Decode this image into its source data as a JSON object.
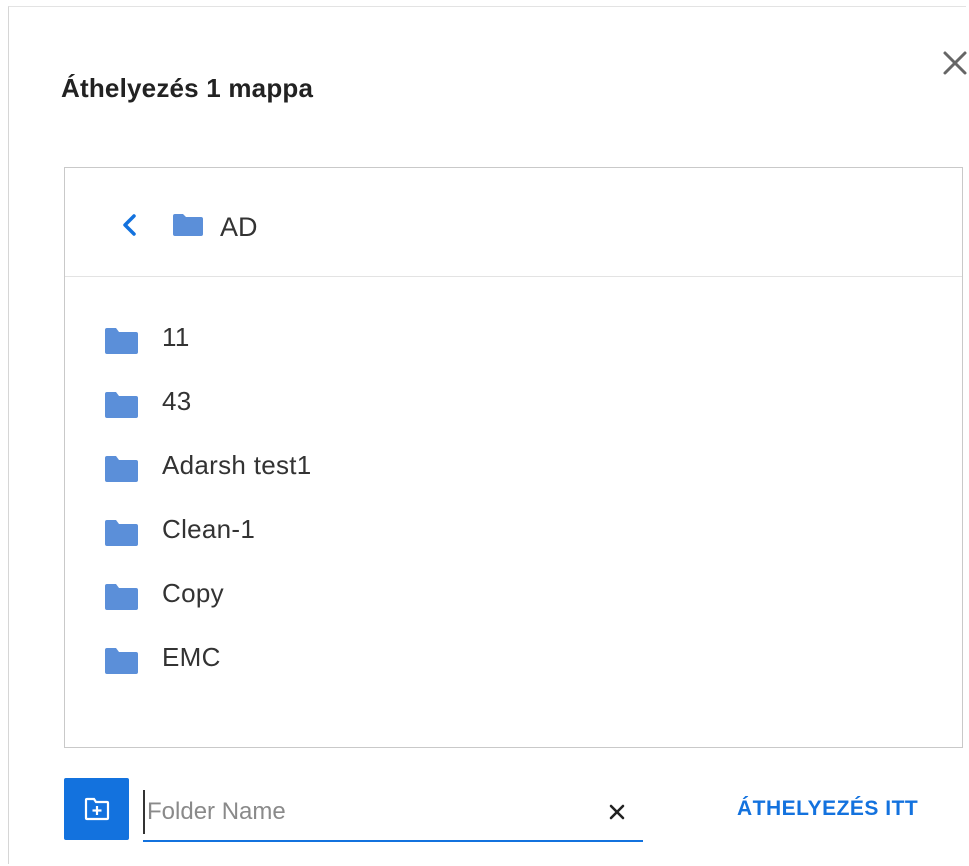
{
  "dialog": {
    "title": "Áthelyezés 1 mappa",
    "close_icon": "close-icon"
  },
  "breadcrumb": {
    "back_icon": "chevron-left-icon",
    "folder_icon": "folder-icon",
    "current_folder": "AD"
  },
  "folders": [
    {
      "name": "11",
      "icon": "folder-icon"
    },
    {
      "name": "43",
      "icon": "folder-icon"
    },
    {
      "name": "Adarsh test1",
      "icon": "folder-icon"
    },
    {
      "name": "Clean-1",
      "icon": "folder-icon"
    },
    {
      "name": "Copy",
      "icon": "folder-icon"
    },
    {
      "name": "EMC",
      "icon": "folder-icon"
    }
  ],
  "footer": {
    "new_folder_icon": "new-folder-icon",
    "folder_name_value": "",
    "folder_name_placeholder": "Folder Name",
    "clear_icon": "clear-icon",
    "move_here_label": "ÁTHELYEZÉS ITT"
  },
  "colors": {
    "accent": "#1372de",
    "folder": "#5b8fd9",
    "text": "#333333"
  }
}
